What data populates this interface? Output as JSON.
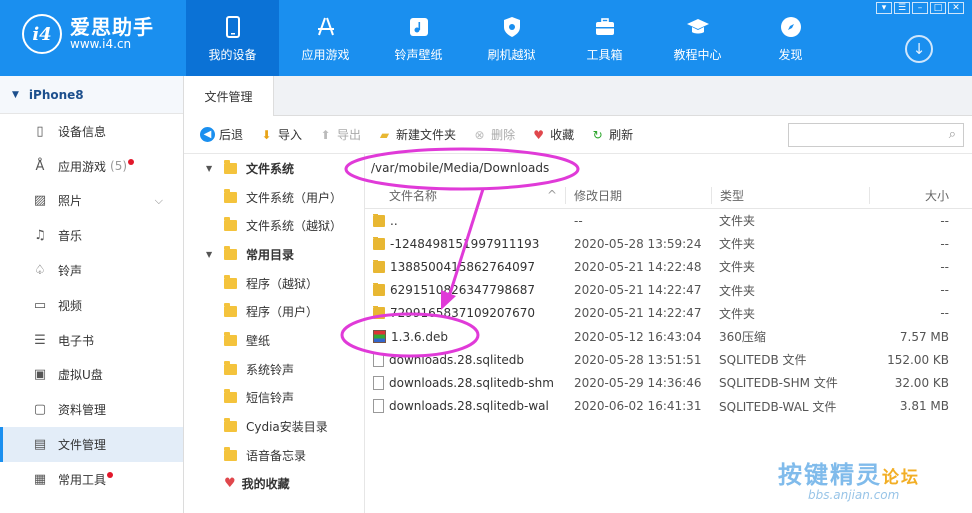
{
  "app": {
    "logo_mark": "i4",
    "name": "爱思助手",
    "url": "www.i4.cn"
  },
  "nav": [
    {
      "label": "我的设备",
      "icon": "phone-icon",
      "active": true
    },
    {
      "label": "应用游戏",
      "icon": "appstore-icon"
    },
    {
      "label": "铃声壁纸",
      "icon": "music-icon"
    },
    {
      "label": "刷机越狱",
      "icon": "shield-icon"
    },
    {
      "label": "工具箱",
      "icon": "toolbox-icon"
    },
    {
      "label": "教程中心",
      "icon": "graduation-cap-icon"
    },
    {
      "label": "发现",
      "icon": "compass-icon"
    }
  ],
  "window_controls": [
    "▾",
    "☰",
    "–",
    "□",
    "✕"
  ],
  "download_icon": "↓",
  "device": {
    "name": "iPhone8",
    "caret": "▼"
  },
  "sidebar": [
    {
      "label": "设备信息",
      "icon": "info-icon"
    },
    {
      "label": "应用游戏",
      "icon": "appstore-icon",
      "count": "(5)",
      "dot": true
    },
    {
      "label": "照片",
      "icon": "photo-icon",
      "chevron": "⌵"
    },
    {
      "label": "音乐",
      "icon": "music-note-icon"
    },
    {
      "label": "铃声",
      "icon": "bell-icon"
    },
    {
      "label": "视频",
      "icon": "video-icon"
    },
    {
      "label": "电子书",
      "icon": "book-icon"
    },
    {
      "label": "虚拟U盘",
      "icon": "usb-icon"
    },
    {
      "label": "资料管理",
      "icon": "folder-icon"
    },
    {
      "label": "文件管理",
      "icon": "file-icon",
      "active": true
    },
    {
      "label": "常用工具",
      "icon": "grid-icon",
      "dot": true
    }
  ],
  "tab": {
    "label": "文件管理"
  },
  "toolbar": {
    "back": "后退",
    "import": "导入",
    "export": "导出",
    "new_folder": "新建文件夹",
    "delete": "删除",
    "favorite": "收藏",
    "refresh": "刷新",
    "search_placeholder": ""
  },
  "tree": [
    {
      "label": "文件系统",
      "level": 0,
      "expanded": true
    },
    {
      "label": "文件系统（用户）",
      "level": 1
    },
    {
      "label": "文件系统（越狱）",
      "level": 1
    },
    {
      "label": "常用目录",
      "level": 0,
      "expanded": true
    },
    {
      "label": "程序（越狱）",
      "level": 1
    },
    {
      "label": "程序（用户）",
      "level": 1
    },
    {
      "label": "壁纸",
      "level": 1
    },
    {
      "label": "系统铃声",
      "level": 1
    },
    {
      "label": "短信铃声",
      "level": 1
    },
    {
      "label": "Cydia安装目录",
      "level": 1
    },
    {
      "label": "语音备忘录",
      "level": 1
    },
    {
      "label": "我的收藏",
      "level": 0,
      "favorite": true
    }
  ],
  "path": "/var/mobile/Media/Downloads",
  "columns": {
    "name": "文件名称",
    "sort": "^",
    "modified": "修改日期",
    "type": "类型",
    "size": "大小"
  },
  "files": [
    {
      "name": "..",
      "modified": "--",
      "type": "文件夹",
      "size": "--",
      "kind": "folder"
    },
    {
      "name": "-1248498151997911193",
      "modified": "2020-05-28 13:59:24",
      "type": "文件夹",
      "size": "--",
      "kind": "folder"
    },
    {
      "name": "1388500415862764097",
      "modified": "2020-05-21 14:22:48",
      "type": "文件夹",
      "size": "--",
      "kind": "folder"
    },
    {
      "name": "6291510826347798687",
      "modified": "2020-05-21 14:22:47",
      "type": "文件夹",
      "size": "--",
      "kind": "folder"
    },
    {
      "name": "7299165837109207670",
      "modified": "2020-05-21 14:22:47",
      "type": "文件夹",
      "size": "--",
      "kind": "folder"
    },
    {
      "name": "1.3.6.deb",
      "modified": "2020-05-12 16:43:04",
      "type": "360压缩",
      "size": "7.57 MB",
      "kind": "rar"
    },
    {
      "name": "downloads.28.sqlitedb",
      "modified": "2020-05-28 13:51:51",
      "type": "SQLITEDB 文件",
      "size": "152.00 KB",
      "kind": "file"
    },
    {
      "name": "downloads.28.sqlitedb-shm",
      "modified": "2020-05-29 14:36:46",
      "type": "SQLITEDB-SHM 文件",
      "size": "32.00 KB",
      "kind": "file"
    },
    {
      "name": "downloads.28.sqlitedb-wal",
      "modified": "2020-06-02 16:41:31",
      "type": "SQLITEDB-WAL 文件",
      "size": "3.81 MB",
      "kind": "file"
    }
  ],
  "watermark": {
    "main": "按键精灵",
    "accent": "论坛",
    "sub": "bbs.anjian.com"
  },
  "colors": {
    "brand": "#1a8fef",
    "annotation": "#e03ad8"
  }
}
